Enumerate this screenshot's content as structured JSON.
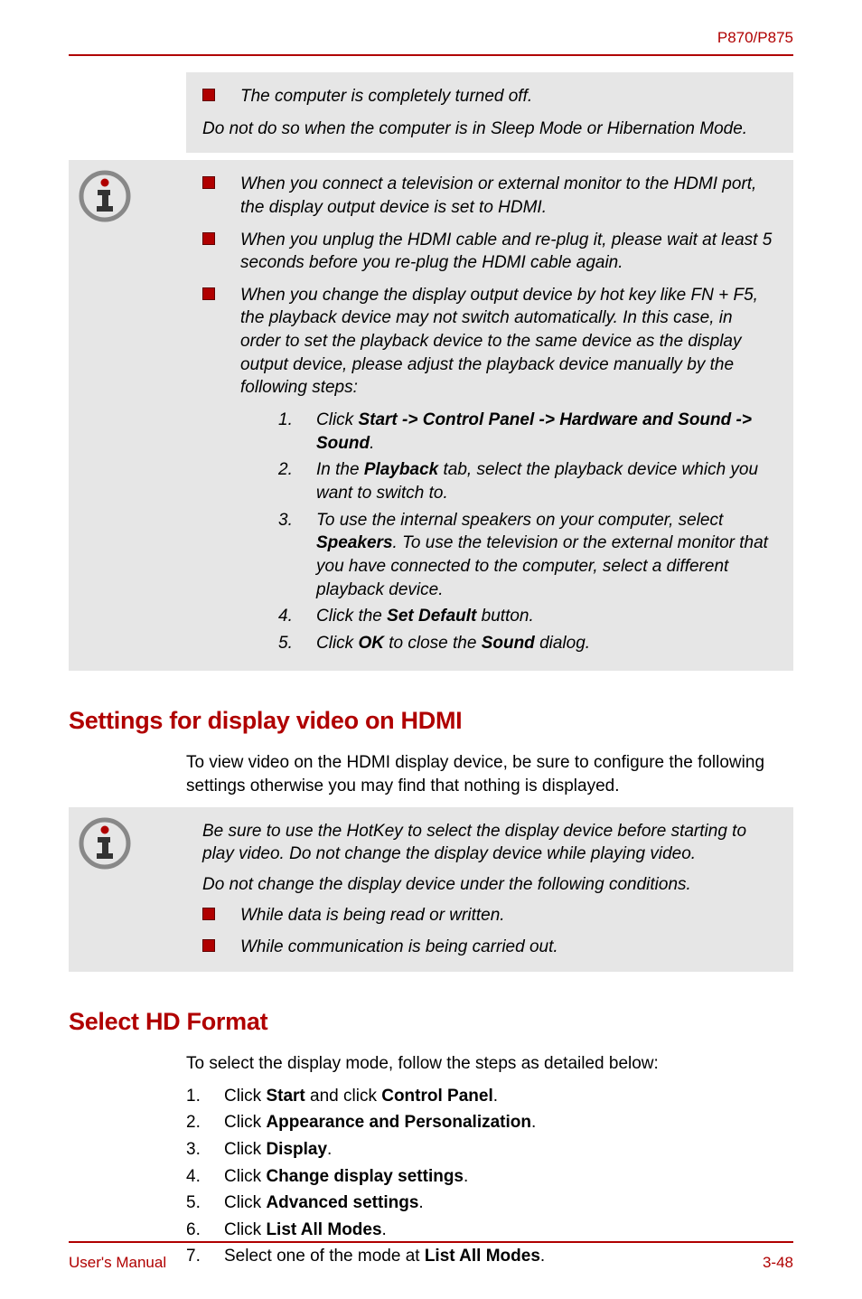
{
  "header": {
    "model": "P870/P875"
  },
  "block1": {
    "bullet1": "The computer is completely turned off.",
    "para1": "Do not do so when the computer is in Sleep Mode or Hibernation Mode."
  },
  "block2": {
    "bullet1": "When you connect a television or external monitor to the HDMI port, the display output device is set to HDMI.",
    "bullet2": "When you unplug the HDMI cable and re-plug it, please wait at least 5 seconds before you re-plug the HDMI cable again.",
    "bullet3": "When you change the display output device by hot key like FN + F5, the playback device may not switch automatically. In this case, in order to set the playback device to the same device as the display output device, please adjust the playback device manually by the following steps:",
    "steps": {
      "n1": "1.",
      "s1_pre": "Click ",
      "s1_b": "Start -> Control Panel -> Hardware and Sound -> Sound",
      "s1_post": ".",
      "n2": "2.",
      "s2_pre": "In the ",
      "s2_b": "Playback",
      "s2_post": " tab, select the playback device which you want to switch to.",
      "n3": "3.",
      "s3_pre": "To use the internal speakers on your computer, select ",
      "s3_b": "Speakers",
      "s3_post": ". To use the television or the external monitor that you have connected to the computer, select a different playback device.",
      "n4": "4.",
      "s4_pre": "Click the ",
      "s4_b": "Set Default",
      "s4_post": " button.",
      "n5": "5.",
      "s5_pre": "Click ",
      "s5_b": "OK",
      "s5_mid": " to close the ",
      "s5_b2": "Sound",
      "s5_post": " dialog."
    }
  },
  "section1": {
    "heading": "Settings for display video on HDMI",
    "para": "To view video on the HDMI display device, be sure to configure the following settings otherwise you may find that nothing is displayed."
  },
  "block3": {
    "para1": "Be sure to use the HotKey to select the display device before starting to play video. Do not change the display device while playing video.",
    "para2": "Do not change the display device under the following conditions.",
    "bullet1": "While data is being read or written.",
    "bullet2": "While communication is being carried out."
  },
  "section2": {
    "heading": "Select HD Format",
    "para": "To select the display mode, follow the steps as detailed below:",
    "steps": {
      "n1": "1.",
      "s1_pre": "Click ",
      "s1_b": "Start",
      "s1_mid": " and click ",
      "s1_b2": "Control Panel",
      "s1_post": ".",
      "n2": "2.",
      "s2_pre": "Click ",
      "s2_b": "Appearance and Personalization",
      "s2_post": ".",
      "n3": "3.",
      "s3_pre": "Click ",
      "s3_b": "Display",
      "s3_post": ".",
      "n4": "4.",
      "s4_pre": "Click ",
      "s4_b": "Change display settings",
      "s4_post": ".",
      "n5": "5.",
      "s5_pre": "Click ",
      "s5_b": "Advanced settings",
      "s5_post": ".",
      "n6": "6.",
      "s6_pre": "Click ",
      "s6_b": "List All Modes",
      "s6_post": ".",
      "n7": "7.",
      "s7_pre": "Select one of the mode at ",
      "s7_b": "List All Modes",
      "s7_post": "."
    }
  },
  "footer": {
    "left": "User's Manual",
    "right": "3-48"
  }
}
